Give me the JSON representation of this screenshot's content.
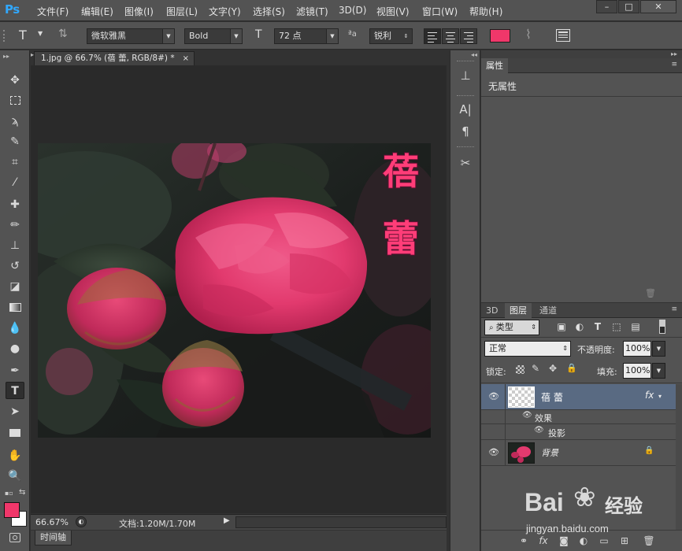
{
  "app": {
    "logo": "Ps"
  },
  "menu": [
    "文件(F)",
    "编辑(E)",
    "图像(I)",
    "图层(L)",
    "文字(Y)",
    "选择(S)",
    "滤镜(T)",
    "3D(D)",
    "视图(V)",
    "窗口(W)",
    "帮助(H)"
  ],
  "window_controls": {
    "minimize": "–",
    "maximize": "□",
    "close": "✕"
  },
  "options": {
    "tool_glyph": "T",
    "font_family": "微软雅黑",
    "font_style": "Bold",
    "font_size": "72 点",
    "aa_label": "ªa",
    "anti_alias": "锐利",
    "text_color": "#f0376a"
  },
  "document": {
    "tab_title": "1.jpg @ 66.7% (蓓 蕾, RGB/8#) *",
    "overlay_text": [
      "蓓",
      "蕾"
    ],
    "overlay_color": "#ff3d78",
    "zoom": "66.67%",
    "doc_info": "文档:1.20M/1.70M"
  },
  "timeline": {
    "label": "时间轴"
  },
  "properties": {
    "tab": "属性",
    "empty_message": "无属性"
  },
  "layers_panel": {
    "tabs": [
      "3D",
      "图层",
      "通道"
    ],
    "filter_kind": "类型",
    "blend_mode": "正常",
    "opacity_label": "不透明度:",
    "opacity_value": "100%",
    "lock_label": "锁定:",
    "fill_label": "填充:",
    "fill_value": "100%",
    "layers": [
      {
        "name": "蓓 蕾",
        "fx": "fx",
        "effects_label": "效果",
        "effect": "投影"
      },
      {
        "name": "背景"
      }
    ]
  },
  "watermark": {
    "brand": "Bai",
    "brand2": "经验",
    "url": "jingyan.baidu.com"
  }
}
